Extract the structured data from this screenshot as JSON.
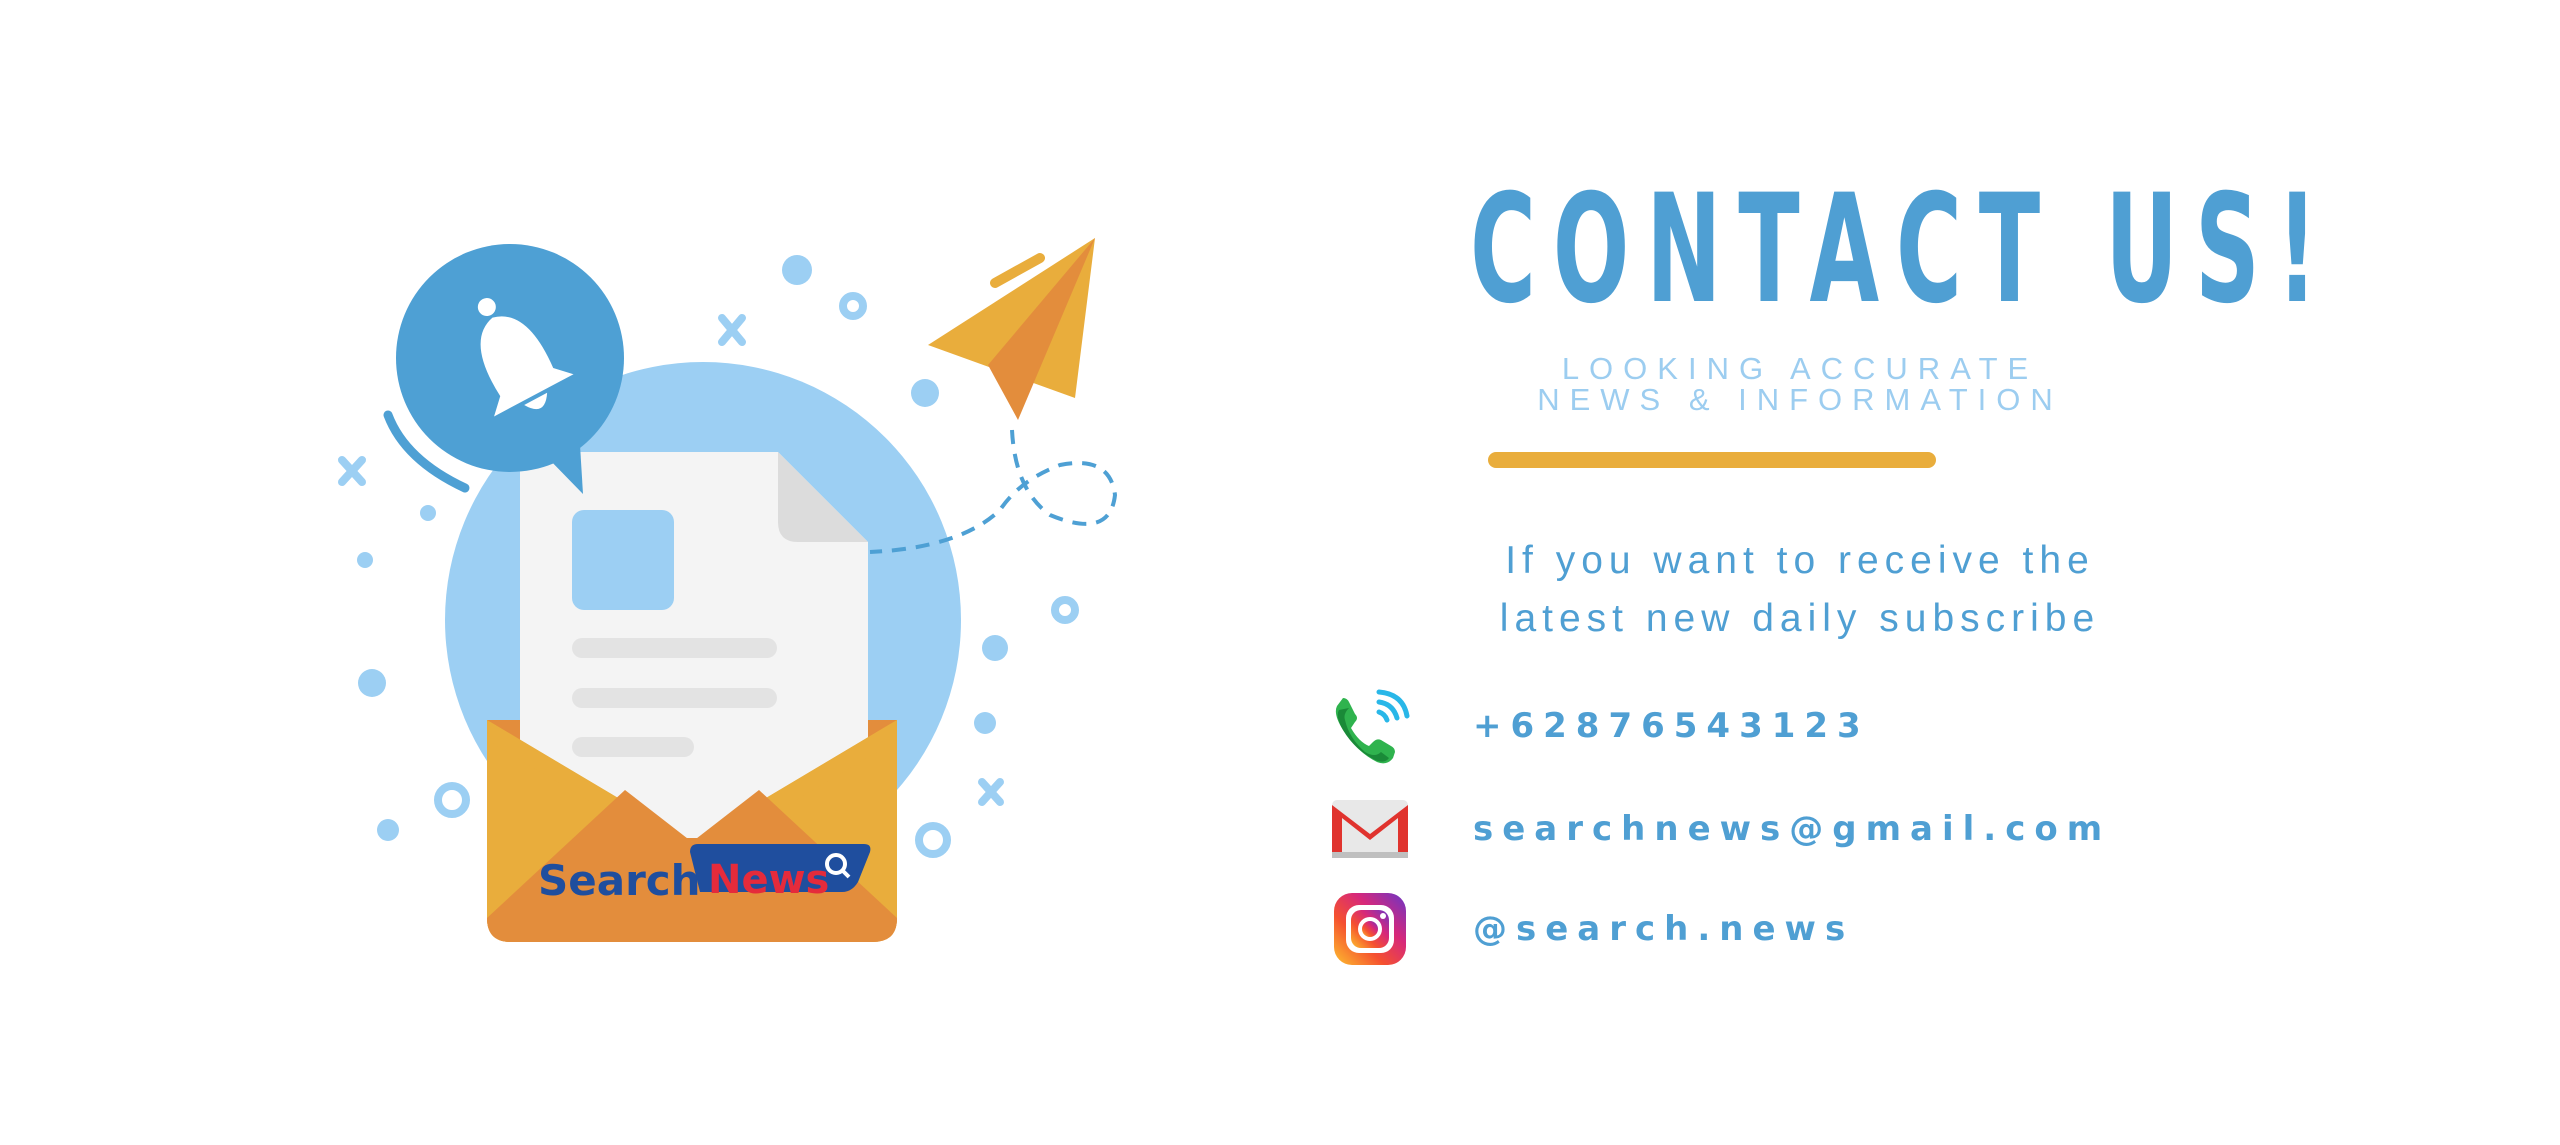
{
  "heading": "CONTACT US!",
  "subtitle": {
    "line1": "LOOKING ACCURATE",
    "line2": "NEWS & INFORMATION"
  },
  "tagline": {
    "line1": "If you want to receive the",
    "line2": "latest new daily subscribe"
  },
  "contacts": {
    "phone": {
      "icon": "phone-signal-icon",
      "value": "+62876543123"
    },
    "email": {
      "icon": "gmail-icon",
      "value": "searchnews@gmail.com"
    },
    "instagram": {
      "icon": "instagram-icon",
      "value": "@search.news"
    }
  },
  "logo": {
    "part1": "Search",
    "part2": "News"
  },
  "colors": {
    "primary_blue": "#4f9fd3",
    "light_blue": "#9ccdf0",
    "accent_orange": "#e9ad3c",
    "envelope_dark": "#e38d3c",
    "logo_navy": "#1f4e9e",
    "logo_red": "#e52b3b"
  }
}
